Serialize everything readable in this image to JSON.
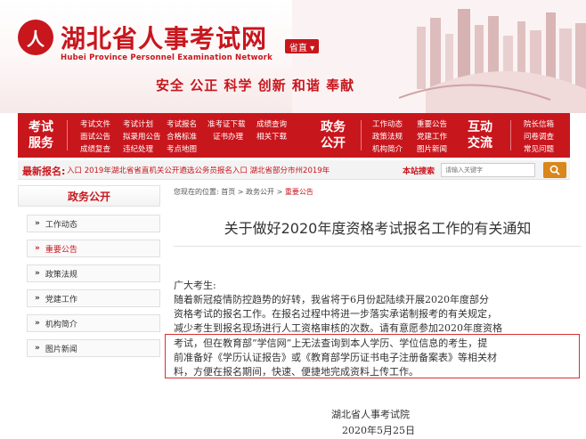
{
  "header": {
    "logo_emblem_text": "人",
    "title": "湖北省人事考试网",
    "subtitle": "Hubei Province Personnel Examination Network",
    "region_select": "省直 ▾",
    "slogan": "安全 公正 科学 创新 和谐 奉献"
  },
  "nav": {
    "groups": [
      {
        "title": [
          "考试",
          "服务"
        ],
        "links": [
          "考试文件",
          "考试计划",
          "考试报名",
          "准考证下载",
          "成绩查询",
          "面试公告",
          "拟录用公告",
          "合格标准",
          "证书办理",
          "相关下载",
          "成绩复查",
          "违纪处理",
          "考点地图"
        ]
      },
      {
        "title": [
          "政务",
          "公开"
        ],
        "links": [
          "工作动态",
          "重要公告",
          "政策法规",
          "党建工作",
          "机构简介",
          "图片新闻"
        ]
      },
      {
        "title": [
          "互动",
          "交流"
        ],
        "links": [
          "院长信箱",
          "问卷调查",
          "常见问题"
        ]
      }
    ]
  },
  "ticker": {
    "label": "最新报名:",
    "text": "入口   2019年湖北省省直机关公开遴选公务员报名入口     湖北省部分市州2019年",
    "search_label": "本站搜索",
    "search_placeholder": "请输入关键字"
  },
  "sidebar": {
    "header": "政务公开",
    "items": [
      {
        "label": "工作动态",
        "active": false
      },
      {
        "label": "重要公告",
        "active": true
      },
      {
        "label": "政策法规",
        "active": false
      },
      {
        "label": "党建工作",
        "active": false
      },
      {
        "label": "机构简介",
        "active": false
      },
      {
        "label": "图片新闻",
        "active": false
      }
    ]
  },
  "breadcrumb": {
    "prefix": "您现在的位置: 首页 > 政务公开 > ",
    "current": "重要公告"
  },
  "article": {
    "title": "关于做好2020年度资格考试报名工作的有关通知",
    "greeting": "广大考生:",
    "lines": [
      "    随着新冠疫情防控趋势的好转，我省将于6月份起陆续开展2020年度部分",
      "资格考试的报名工作。在报名过程中将进一步落实承诺制报考的有关规定，",
      "减少考生到报名现场进行人工资格审核的次数。请有意愿参加2020年度资格",
      "考试，但在教育部“学信网”上无法查询到本人学历、学位信息的考生，提",
      "前准备好《学历认证报告》或《教育部学历证书电子注册备案表》等相关材",
      "料，方便在报名期间，快速、便捷地完成资料上传工作。"
    ],
    "signature_org": "湖北省人事考试院",
    "signature_date": "2020年5月25日"
  },
  "colors": {
    "brand_red": "#c8161d",
    "search_button": "#d9861a",
    "highlight_border": "#d93030"
  }
}
